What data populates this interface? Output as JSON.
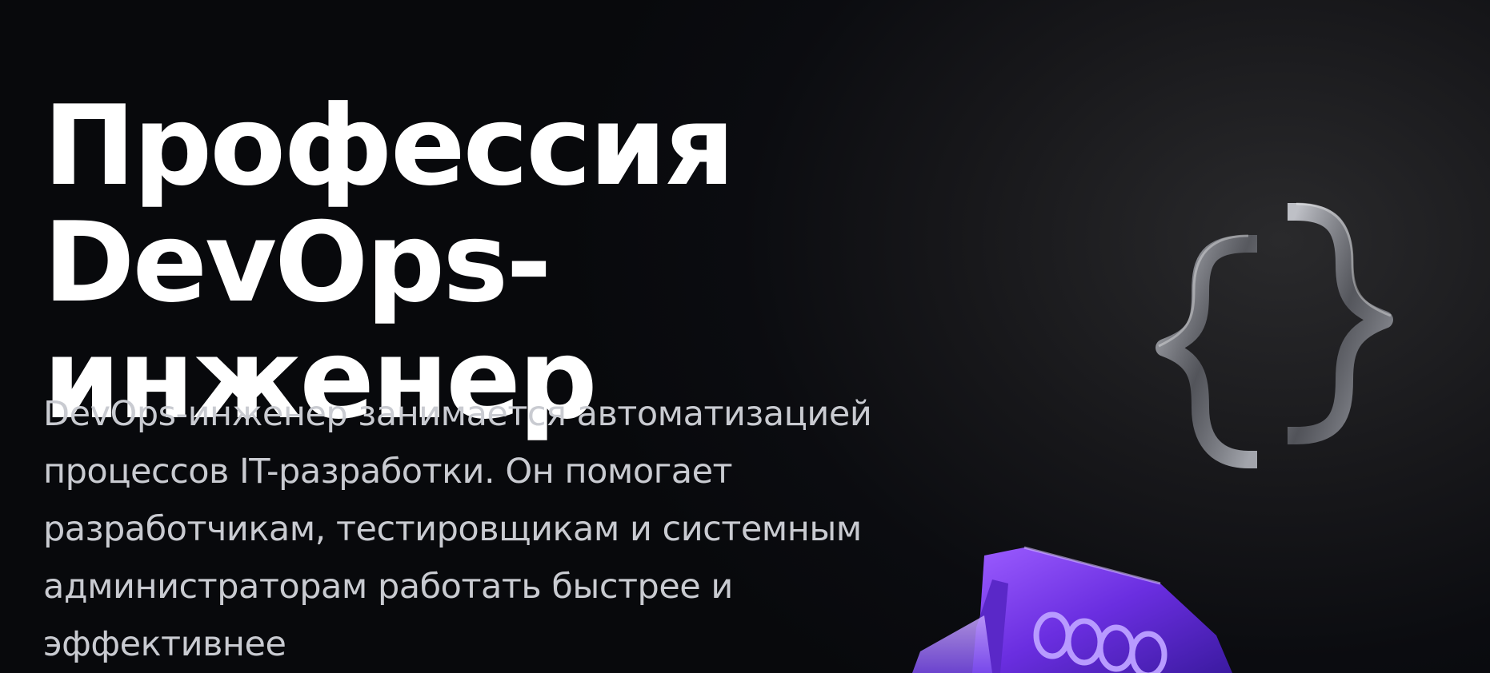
{
  "hero": {
    "title": "Профессия DevOps-\nинженер",
    "description": "DevOps-инженер занимается автоматизацией процессов IT-разработки. Он помогает разработчикам, тестировщикам и системным администраторам работать быстрее и эффективнее"
  },
  "decorations": {
    "braces": "curly-braces-3d-icon",
    "purple": "purple-3d-object-illustration"
  },
  "colors": {
    "background": "#0b0c10",
    "title": "#ffffff",
    "description": "#c9cbd1",
    "accent": "#7b3cf0"
  }
}
